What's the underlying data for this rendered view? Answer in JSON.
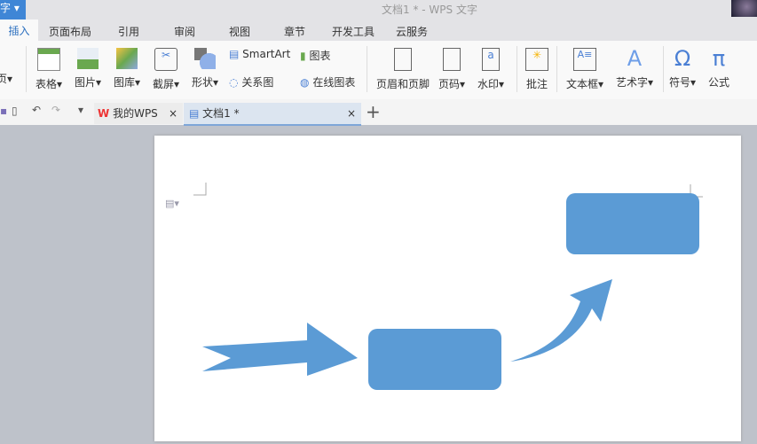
{
  "title": "文档1 * - WPS 文字",
  "app_button": "字",
  "menu": [
    "插入",
    "页面布局",
    "引用",
    "审阅",
    "视图",
    "章节",
    "开发工具",
    "云服务"
  ],
  "ribbon": {
    "page": "页",
    "table": "表格",
    "picture": "图片",
    "gallery": "图库",
    "screenshot": "截屏",
    "shapes": "形状",
    "smartart": "SmartArt",
    "chart": "图表",
    "relation": "关系图",
    "online_chart": "在线图表",
    "header_footer": "页眉和页脚",
    "page_num": "页码",
    "watermark": "水印",
    "comment": "批注",
    "textbox": "文本框",
    "wordart": "艺术字",
    "symbol": "符号",
    "formula": "公式"
  },
  "doc_tabs": [
    {
      "label": "我的WPS"
    },
    {
      "label": "文档1 *"
    }
  ],
  "colors": {
    "shape": "#5b9bd5",
    "accent": "#3f86d6"
  }
}
